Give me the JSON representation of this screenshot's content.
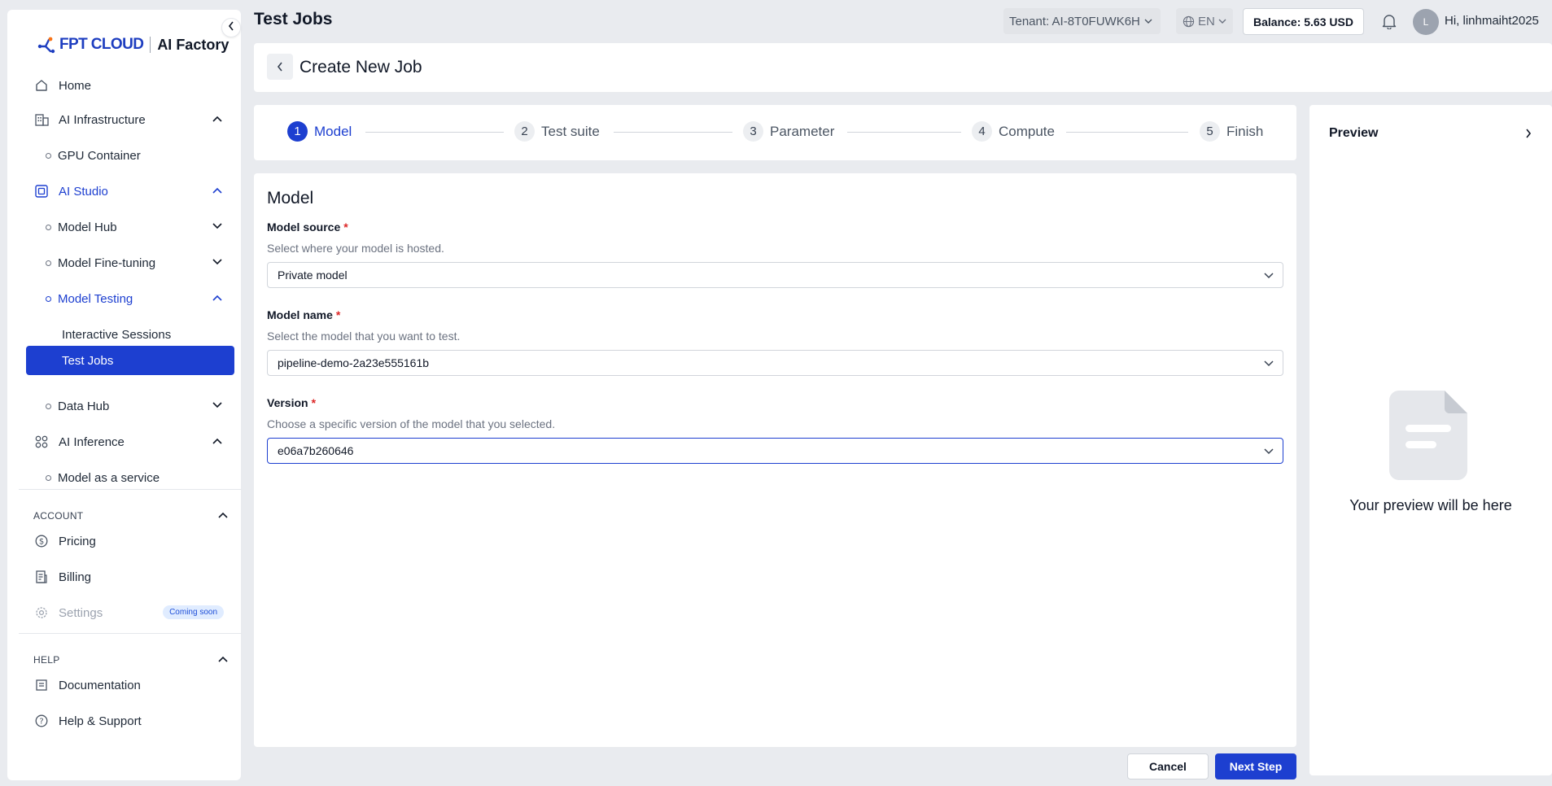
{
  "brand": {
    "name": "FPT CLOUD",
    "product": "AI Factory"
  },
  "sidebar": {
    "home": "Home",
    "ai_infrastructure": "AI Infrastructure",
    "gpu_container": "GPU Container",
    "ai_studio": "AI Studio",
    "model_hub": "Model Hub",
    "model_finetuning": "Model Fine-tuning",
    "model_testing": "Model Testing",
    "interactive_sessions": "Interactive Sessions",
    "test_jobs": "Test Jobs",
    "data_hub": "Data Hub",
    "ai_inference": "AI Inference",
    "model_as_a_service": "Model as a service",
    "account_section": "ACCOUNT",
    "pricing": "Pricing",
    "billing": "Billing",
    "settings": "Settings",
    "coming_soon": "Coming soon",
    "help_section": "HELP",
    "documentation": "Documentation",
    "help_support": "Help & Support"
  },
  "header": {
    "page_title": "Test Jobs",
    "tenant": "Tenant: AI-8T0FUWK6H",
    "language": "EN",
    "balance": "Balance: 5.63 USD",
    "avatar_initial": "L",
    "greeting": "Hi, linhmaiht2025"
  },
  "create": {
    "title": "Create New Job"
  },
  "steps": [
    {
      "num": "1",
      "label": "Model"
    },
    {
      "num": "2",
      "label": "Test suite"
    },
    {
      "num": "3",
      "label": "Parameter"
    },
    {
      "num": "4",
      "label": "Compute"
    },
    {
      "num": "5",
      "label": "Finish"
    }
  ],
  "form": {
    "heading": "Model",
    "model_source": {
      "label": "Model source",
      "required": "*",
      "hint": "Select where your model is hosted.",
      "value": "Private model"
    },
    "model_name": {
      "label": "Model name",
      "required": "*",
      "hint": "Select the model that you want to test.",
      "value": "pipeline-demo-2a23e555161b"
    },
    "version": {
      "label": "Version",
      "required": "*",
      "hint": "Choose a specific version of the model that you selected.",
      "value": "e06a7b260646"
    }
  },
  "preview": {
    "title": "Preview",
    "empty_text": "Your preview will be here"
  },
  "footer": {
    "cancel": "Cancel",
    "next": "Next Step"
  },
  "colors": {
    "accent": "#1d3fd0",
    "required": "#dc2626",
    "background": "#e9ebef"
  }
}
